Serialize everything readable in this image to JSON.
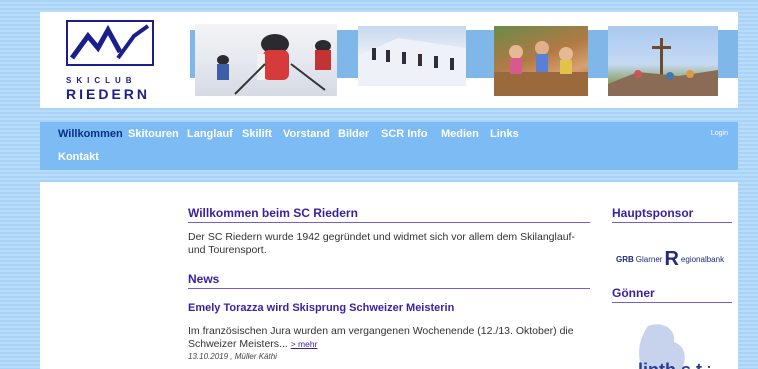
{
  "logo": {
    "line1": "SKICLUB",
    "line2": "RIEDERN"
  },
  "nav": {
    "items": [
      {
        "label": "Willkommen",
        "active": true
      },
      {
        "label": "Skitouren",
        "active": false
      },
      {
        "label": "Langlauf",
        "active": false
      },
      {
        "label": "Skilift",
        "active": false
      },
      {
        "label": "Vorstand",
        "active": false
      },
      {
        "label": "Bilder",
        "active": false
      },
      {
        "label": "SCR Info",
        "active": false
      },
      {
        "label": "Medien",
        "active": false
      },
      {
        "label": "Links",
        "active": false
      },
      {
        "label": "Kontakt",
        "active": false
      }
    ],
    "login": "Login"
  },
  "main": {
    "welcome_title": "Willkommen beim SC Riedern",
    "welcome_text": "Der SC Riedern wurde 1942 gegründet und widmet sich vor allem dem Skilanglauf- und Tourensport.",
    "news_heading": "News",
    "news_item": {
      "title": "Emely Torazza wird Skisprung Schweizer Meisterin",
      "text": "Im französischen Jura wurden am vergangenen Wochenende (12./13. Oktober) die Schweizer Meisters...",
      "more": "> mehr",
      "meta": "13.10.2019 , Müller Käthi"
    }
  },
  "aside": {
    "main_sponsor_heading": "Hauptsponsor",
    "sponsor_abbr": "GRB",
    "sponsor_name_1": "Glarner",
    "sponsor_r": "R",
    "sponsor_name_2": "egionalbank",
    "goenner_heading": "Gönner",
    "goenner_text": "linth.s.t.z"
  },
  "colors": {
    "accent": "#3b1fa3",
    "nav": "#7cbbf3",
    "nav_active": "#0b2f84",
    "logo": "#1a1f8c"
  }
}
